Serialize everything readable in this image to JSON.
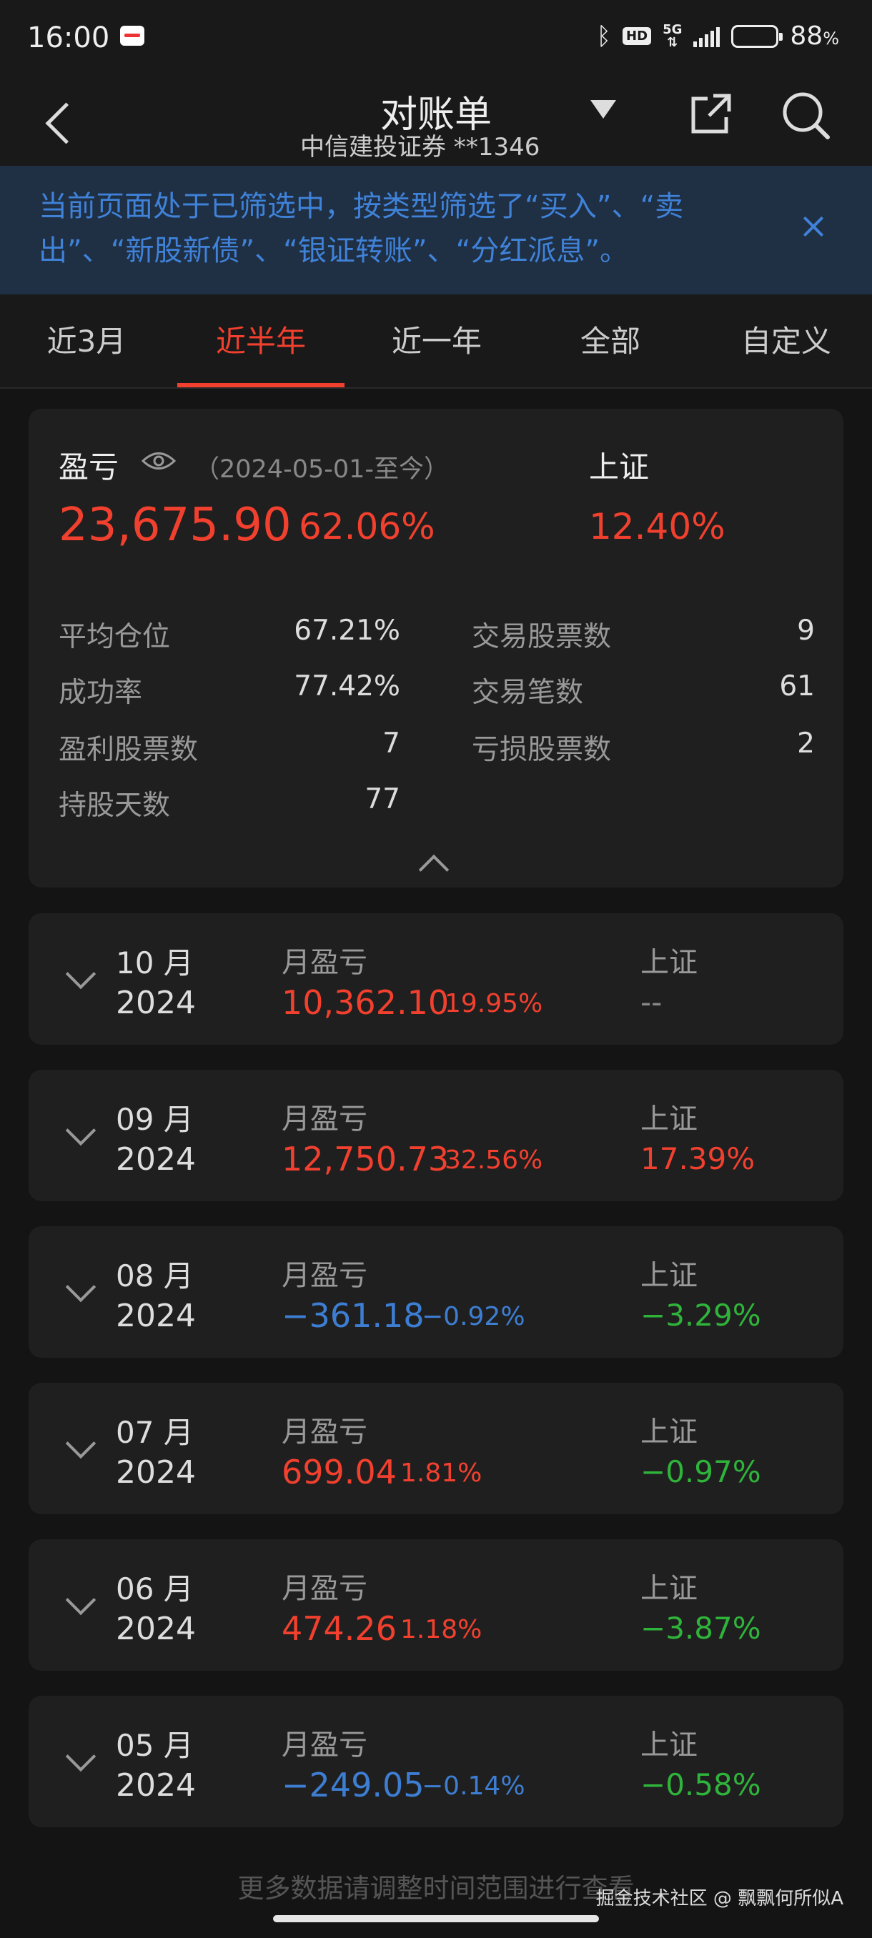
{
  "status": {
    "time": "16:00",
    "network": "5G",
    "hd": "HD",
    "battery": "88",
    "battery_unit": "%",
    "battery_level": 0.88
  },
  "header": {
    "title": "对账单",
    "subtitle": "中信建投证券 **1346"
  },
  "filter_banner": {
    "text": "当前页面处于已筛选中，按类型筛选了“买入”、“卖出”、“新股新债”、“银证转账”、“分红派息”。"
  },
  "tabs": [
    {
      "label": "近3月",
      "active": false
    },
    {
      "label": "近半年",
      "active": true
    },
    {
      "label": "近一年",
      "active": false
    },
    {
      "label": "全部",
      "active": false
    },
    {
      "label": "自定义",
      "active": false
    }
  ],
  "summary": {
    "pnl_label": "盈亏",
    "date_range": "（2024-05-01-至今）",
    "index_label": "上证",
    "pnl_amount": "23,675.90",
    "pnl_pct": "62.06%",
    "index_pct": "12.40%",
    "stats": [
      {
        "label": "平均仓位",
        "value": "67.21%"
      },
      {
        "label": "交易股票数",
        "value": "9"
      },
      {
        "label": "成功率",
        "value": "77.42%"
      },
      {
        "label": "交易笔数",
        "value": "61"
      },
      {
        "label": "盈利股票数",
        "value": "7"
      },
      {
        "label": "亏损股票数",
        "value": "2"
      },
      {
        "label": "持股天数",
        "value": "77"
      }
    ]
  },
  "months": [
    {
      "month": "10 月",
      "year": "2024",
      "pnl_label": "月盈亏",
      "amount": "10,362.10",
      "pct": "19.95%",
      "index_label": "上证",
      "index_value": "--",
      "trend": "up",
      "index_trend": "none"
    },
    {
      "month": "09 月",
      "year": "2024",
      "pnl_label": "月盈亏",
      "amount": "12,750.73",
      "pct": "32.56%",
      "index_label": "上证",
      "index_value": "17.39%",
      "trend": "up",
      "index_trend": "up"
    },
    {
      "month": "08 月",
      "year": "2024",
      "pnl_label": "月盈亏",
      "amount": "−361.18",
      "pct": "−0.92%",
      "index_label": "上证",
      "index_value": "−3.29%",
      "trend": "down",
      "index_trend": "down"
    },
    {
      "month": "07 月",
      "year": "2024",
      "pnl_label": "月盈亏",
      "amount": "699.04",
      "pct": "1.81%",
      "index_label": "上证",
      "index_value": "−0.97%",
      "trend": "up",
      "index_trend": "down"
    },
    {
      "month": "06 月",
      "year": "2024",
      "pnl_label": "月盈亏",
      "amount": "474.26",
      "pct": "1.18%",
      "index_label": "上证",
      "index_value": "−3.87%",
      "trend": "up",
      "index_trend": "down"
    },
    {
      "month": "05 月",
      "year": "2024",
      "pnl_label": "月盈亏",
      "amount": "−249.05",
      "pct": "−0.14%",
      "index_label": "上证",
      "index_value": "−0.58%",
      "trend": "down",
      "index_trend": "down"
    }
  ],
  "footer": {
    "text": "更多数据请调整时间范围进行查看",
    "watermark": "掘金技术社区 @ 飘飘何所似A"
  },
  "colors": {
    "gain": "#f2402f",
    "loss_amount": "#3d7ed3",
    "loss_index": "#2fb43b",
    "neutral": "#888888",
    "accent": "#f2402f"
  }
}
